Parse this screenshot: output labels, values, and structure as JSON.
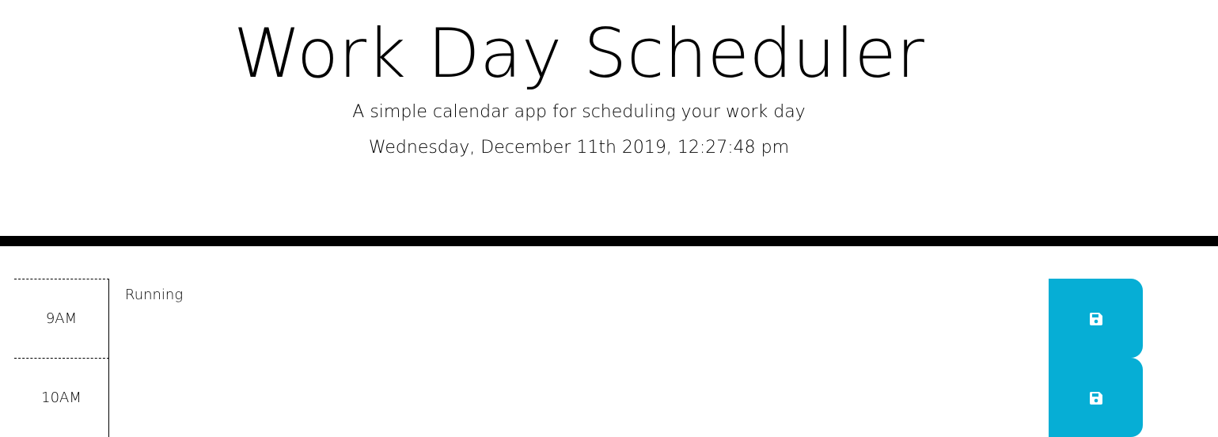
{
  "header": {
    "title": "Work Day Scheduler",
    "lead": "A simple calendar app for scheduling your work day",
    "current_day": "Wednesday, December 11th 2019, 12:27:48 pm"
  },
  "rows": [
    {
      "hour": "9AM",
      "description": "Running",
      "save_icon": "save-icon"
    },
    {
      "hour": "10AM",
      "description": "",
      "save_icon": "save-icon"
    }
  ],
  "colors": {
    "save_button": "#06aed5",
    "divider": "#000000"
  }
}
